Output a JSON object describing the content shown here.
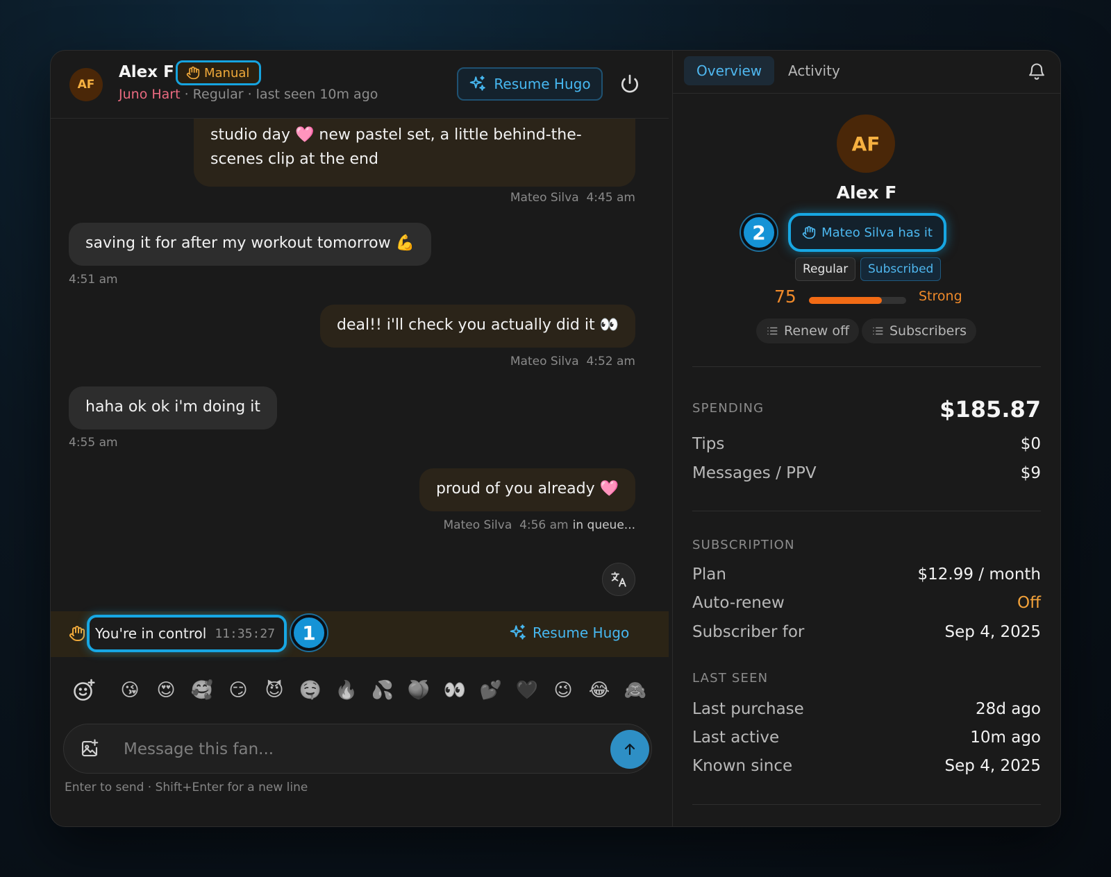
{
  "chat_header": {
    "avatar_initials": "AF",
    "fan_name": "Alex F",
    "mode_badge": "Manual",
    "creator_name": "Juno Hart",
    "status_line": " · Regular · last seen 10m ago",
    "resume_label": "Resume Hugo"
  },
  "messages": [
    {
      "direction": "out",
      "text_line1": "studio day 🩷 new pastel set, a little behind-the-",
      "text_line2": "scenes clip at the end",
      "sender": "Mateo Silva",
      "time": "4:45 am"
    },
    {
      "direction": "in",
      "text": "saving it for after my workout tomorrow 💪",
      "time": "4:51 am"
    },
    {
      "direction": "out",
      "text": "deal!! i'll check you actually did it 👀",
      "sender": "Mateo Silva",
      "time": "4:52 am"
    },
    {
      "direction": "in",
      "text": "haha ok ok i'm doing it",
      "time": "4:55 am"
    },
    {
      "direction": "out",
      "text": "proud of you already 🩷",
      "sender": "Mateo Silva",
      "time": "4:56 am",
      "status": "in queue..."
    }
  ],
  "control_bar": {
    "label": "You're in control",
    "timer": "11:35:27",
    "step": "1",
    "resume_label": "Resume Hugo"
  },
  "emoji_bar": [
    "😘",
    "😍",
    "🥰",
    "😏",
    "😈",
    "🤤",
    "🔥",
    "💦",
    "🍑",
    "👀",
    "💕",
    "🖤",
    "😉",
    "😂",
    "🙈"
  ],
  "composer": {
    "placeholder": "Message this fan...",
    "hint": "Enter to send · Shift+Enter for a new line"
  },
  "panel": {
    "tabs": [
      "Overview",
      "Activity"
    ],
    "active_tab": "Overview",
    "avatar_initials": "AF",
    "name": "Alex F",
    "owner_label": "Mateo Silva has it",
    "step": "2",
    "tags": [
      "Regular",
      "Subscribed"
    ],
    "score": "75",
    "score_fraction": 0.75,
    "score_label": "Strong",
    "chips": [
      "Renew off",
      "Subscribers"
    ]
  },
  "spending": {
    "title": "SPENDING",
    "total": "$185.87",
    "rows": [
      {
        "label": "Tips",
        "value": "$0"
      },
      {
        "label": "Messages / PPV",
        "value": "$9"
      }
    ]
  },
  "subscription": {
    "title": "SUBSCRIPTION",
    "rows": [
      {
        "label": "Plan",
        "value": "$12.99 / month"
      },
      {
        "label": "Auto-renew",
        "value": "Off"
      },
      {
        "label": "Subscriber for",
        "value": "Sep 4, 2025"
      }
    ]
  },
  "last_seen": {
    "title": "LAST SEEN",
    "rows": [
      {
        "label": "Last purchase",
        "value": "28d ago"
      },
      {
        "label": "Last active",
        "value": "10m ago"
      },
      {
        "label": "Known since",
        "value": "Sep 4, 2025"
      }
    ]
  },
  "colors": {
    "accent_blue": "#17a7e3",
    "warning_orange": "#f3a23a",
    "creator_pink": "#ea6a80"
  }
}
